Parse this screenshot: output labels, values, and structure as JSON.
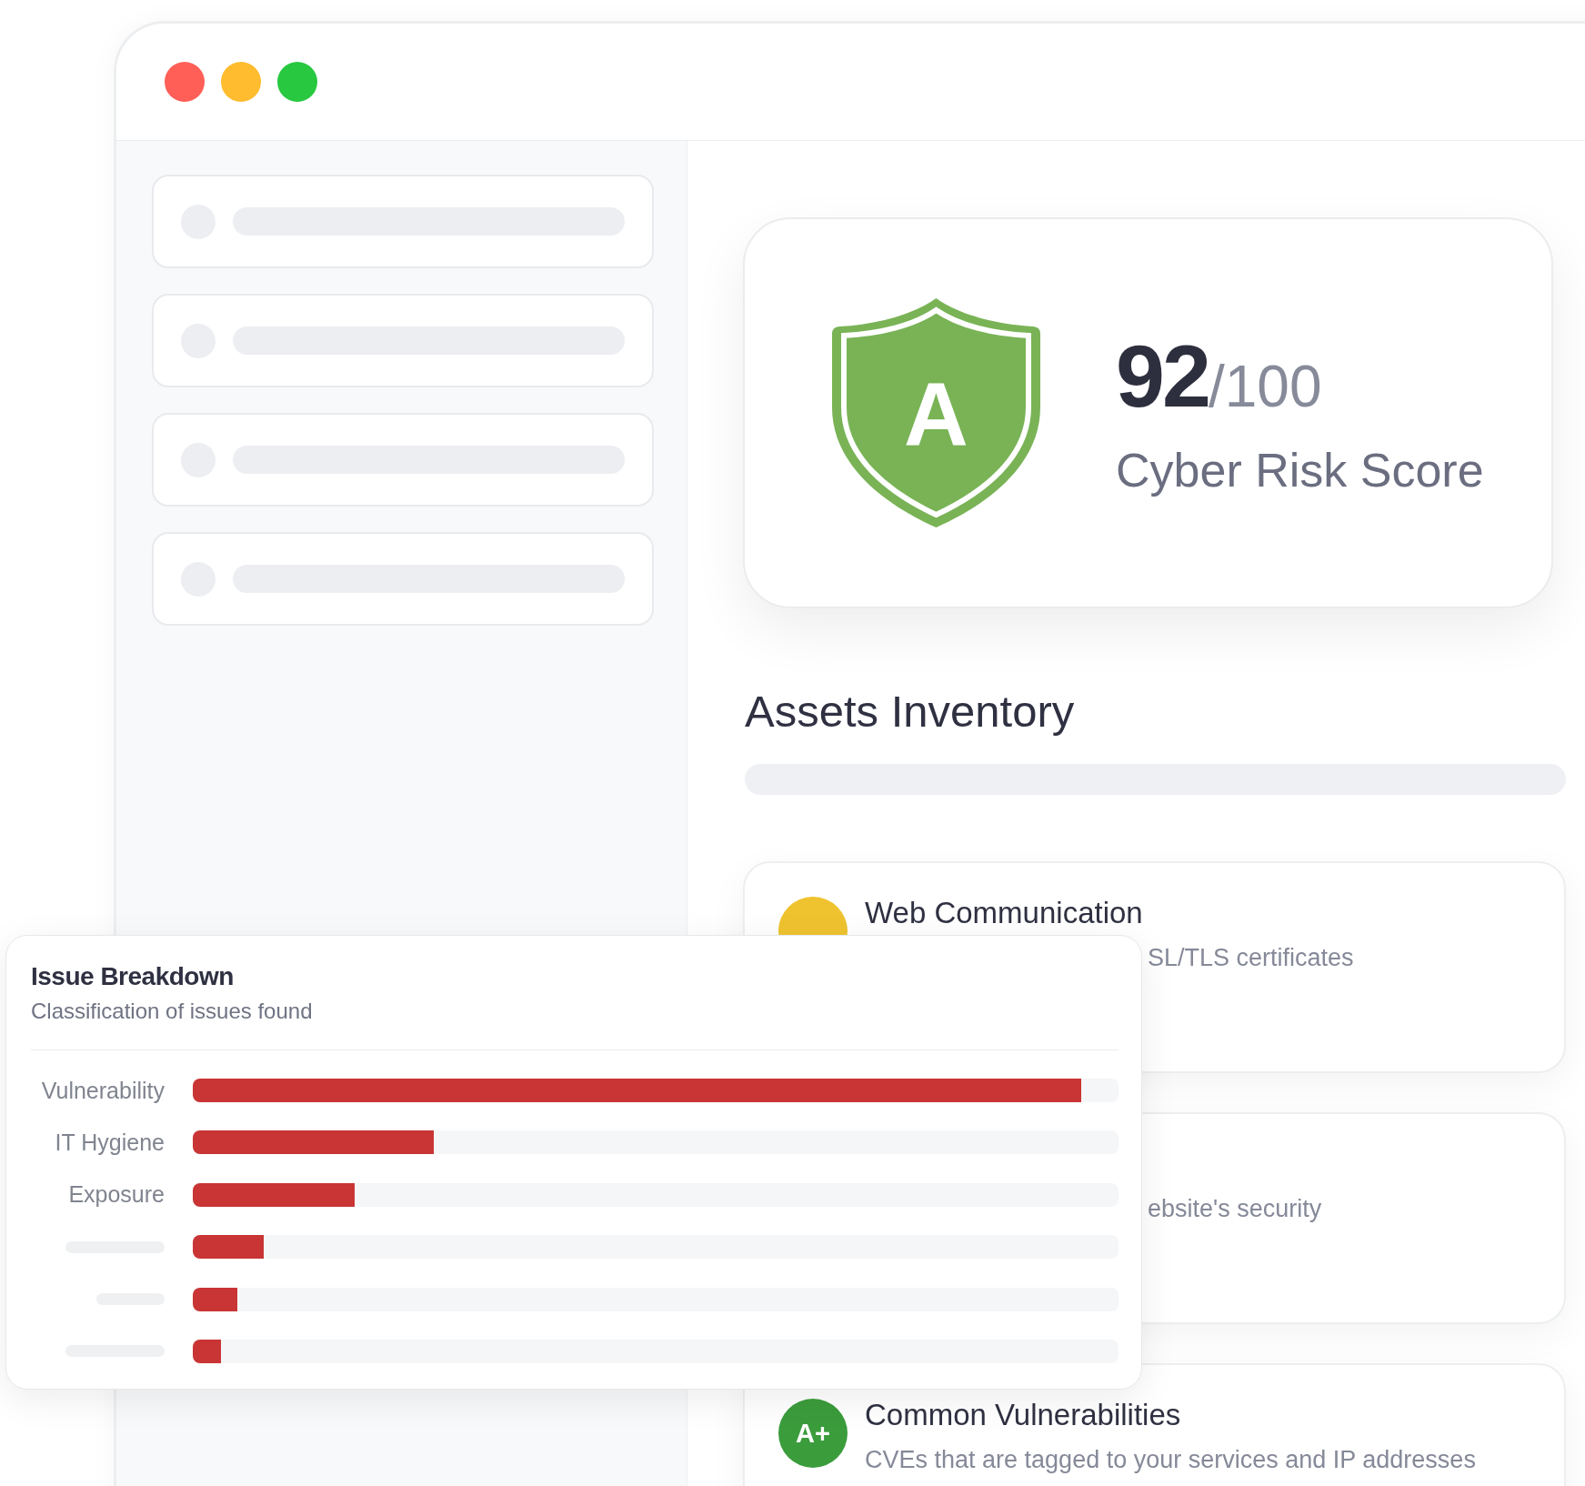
{
  "sidebar": {
    "items": [
      {
        "kind": "placeholder"
      },
      {
        "kind": "placeholder"
      },
      {
        "kind": "placeholder"
      },
      {
        "kind": "placeholder"
      }
    ]
  },
  "score_card": {
    "grade": "A",
    "score": "92",
    "max": "/100",
    "label": "Cyber Risk Score"
  },
  "assets": {
    "heading": "Assets Inventory",
    "cards": [
      {
        "title": "Web Communication",
        "description": "SL/TLS certificates",
        "color": "#efc32f"
      },
      {
        "description": "ebsite's security"
      },
      {
        "grade": "A+",
        "title": "Common Vulnerabilities",
        "description": "CVEs that are tagged to your services and IP addresses",
        "color": "#3b9c3c"
      }
    ]
  },
  "issue_breakdown": {
    "title": "Issue Breakdown",
    "subtitle": "Classification of issues found",
    "rows": [
      {
        "label": "Vulnerability",
        "level": 0.96
      },
      {
        "label": "IT Hygiene",
        "level": 0.26
      },
      {
        "label": "Exposure",
        "level": 0.175
      },
      {
        "level": 0.077
      },
      {
        "level": 0.048
      },
      {
        "level": 0.03
      }
    ]
  }
}
